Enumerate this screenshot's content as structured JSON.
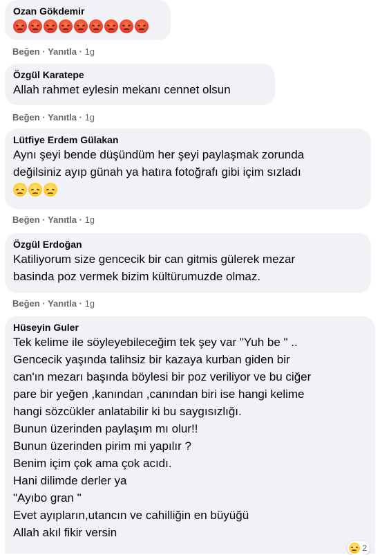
{
  "comments": [
    {
      "author": "Ozan Gökdemir",
      "lines": [],
      "emoji": {
        "kind": "angry",
        "count": 9
      },
      "actions": {
        "like": "Beğen",
        "reply": "Yanıtla",
        "time": "1g"
      }
    },
    {
      "author": "Özgül Karatepe",
      "lines": [
        "Allah rahmet eylesin mekanı cennet olsun"
      ],
      "actions": {
        "like": "Beğen",
        "reply": "Yanıtla",
        "time": "1g"
      }
    },
    {
      "author": "Lütfiye Erdem Gülakan",
      "lines": [
        "Aynı şeyi bende düşündüm her şeyi paylaşmak zorunda",
        "değilsiniz ayıp günah ya hatıra fotoğrafı gibi içim sızladı"
      ],
      "emoji": {
        "kind": "pensive",
        "count": 3
      },
      "actions": {
        "like": "Beğen",
        "reply": "Yanıtla",
        "time": "1g"
      }
    },
    {
      "author": "Özgül Erdoğan",
      "lines": [
        "Katiliyorum size gencecik bir can gitmis gülerek mezar",
        "basinda poz vermek bizim kültürumuzde olmaz."
      ],
      "actions": {
        "like": "Beğen",
        "reply": "Yanıtla",
        "time": "1g"
      }
    },
    {
      "author": "Hüseyin Guler",
      "lines": [
        "Tek kelime ile söyleyebileceğim tek şey var \"Yuh be \" ..",
        "Gencecik yaşında talihsiz bir kazaya kurban giden bir",
        "can'ın mezarı başında böylesi bir poz veriliyor ve bu ciğer",
        "pare bir yeğen ,kanından ,canından biri ise hangi kelime",
        "hangi sözcükler anlatabilir ki bu saygısızlığı.",
        "Bunun üzerinden paylaşım mı olur!!",
        "Bunun üzerinden pirim mi yapılır ?",
        "Benim içim çok ama çok acıdı.",
        "Hani dilimde derler ya",
        "\"Ayıbo gran \"",
        "Evet ayıpların,utancın ve cahilliğin en büyüğü",
        "Allah akıl fikir versin"
      ],
      "reaction_count": "2"
    }
  ],
  "colors": {
    "bubble": "#f0f2f5",
    "meta": "#65676b",
    "text": "#050505"
  }
}
